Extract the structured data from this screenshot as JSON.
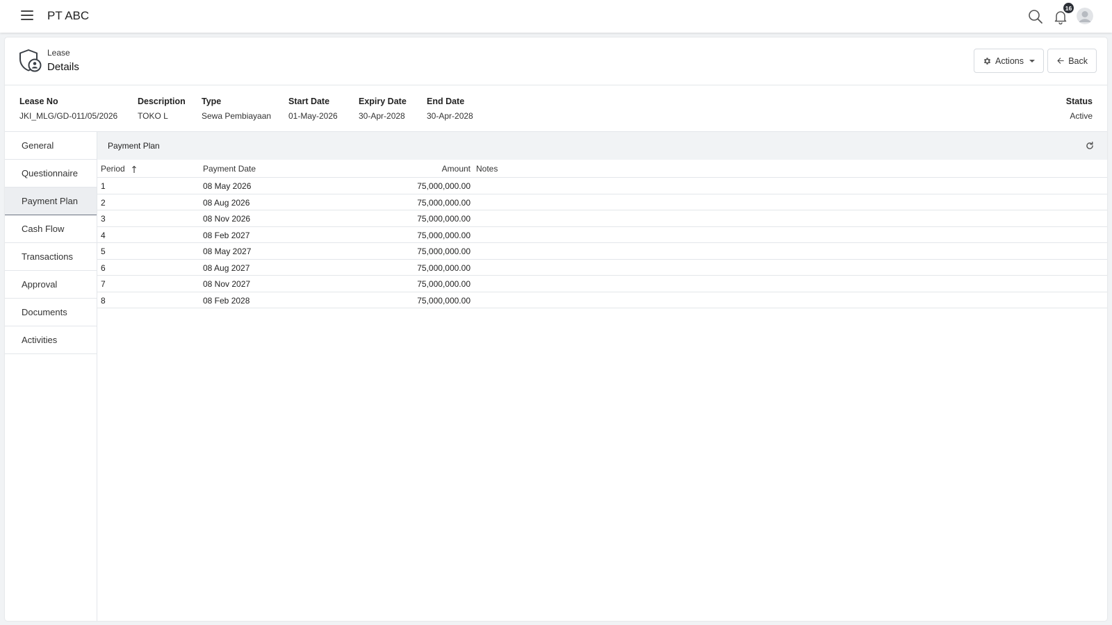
{
  "app": {
    "title": "PT ABC",
    "notification_count": "16"
  },
  "header": {
    "subtitle": "Lease",
    "title": "Details",
    "actions_label": "Actions",
    "back_label": "Back"
  },
  "summary": [
    {
      "label": "Lease No",
      "value": "JKI_MLG/GD-011/05/2026"
    },
    {
      "label": "Description",
      "value": "TOKO L"
    },
    {
      "label": "Type",
      "value": "Sewa Pembiayaan"
    },
    {
      "label": "Start Date",
      "value": "01-May-2026"
    },
    {
      "label": "Expiry Date",
      "value": "30-Apr-2028"
    },
    {
      "label": "End Date",
      "value": "30-Apr-2028"
    },
    {
      "label": "Status",
      "value": "Active"
    }
  ],
  "tabs": [
    {
      "label": "General"
    },
    {
      "label": "Questionnaire"
    },
    {
      "label": "Payment Plan",
      "active": true
    },
    {
      "label": "Cash Flow"
    },
    {
      "label": "Transactions"
    },
    {
      "label": "Approval"
    },
    {
      "label": "Documents"
    },
    {
      "label": "Activities"
    }
  ],
  "panel": {
    "title": "Payment Plan"
  },
  "table": {
    "columns": {
      "period": "Period",
      "payment_date": "Payment Date",
      "amount": "Amount",
      "notes": "Notes"
    },
    "sort": "period-ascending",
    "rows": [
      {
        "period": "1",
        "payment_date": "08 May 2026",
        "amount": "75,000,000.00",
        "notes": ""
      },
      {
        "period": "2",
        "payment_date": "08 Aug 2026",
        "amount": "75,000,000.00",
        "notes": ""
      },
      {
        "period": "3",
        "payment_date": "08 Nov 2026",
        "amount": "75,000,000.00",
        "notes": ""
      },
      {
        "period": "4",
        "payment_date": "08 Feb 2027",
        "amount": "75,000,000.00",
        "notes": ""
      },
      {
        "period": "5",
        "payment_date": "08 May 2027",
        "amount": "75,000,000.00",
        "notes": ""
      },
      {
        "period": "6",
        "payment_date": "08 Aug 2027",
        "amount": "75,000,000.00",
        "notes": ""
      },
      {
        "period": "7",
        "payment_date": "08 Nov 2027",
        "amount": "75,000,000.00",
        "notes": ""
      },
      {
        "period": "8",
        "payment_date": "08 Feb 2028",
        "amount": "75,000,000.00",
        "notes": ""
      }
    ]
  },
  "icons": {
    "menu": "hamburger-menu-icon",
    "search": "search-icon",
    "notifications": "bell-icon",
    "avatar": "user-avatar-icon",
    "module": "shield-user-icon",
    "actions": "gear-icon",
    "back": "arrow-left-icon",
    "refresh": "refresh-icon",
    "sort": "arrow-up-icon"
  },
  "colors": {
    "badge": "#2b2f36",
    "active_tab": "#eceef1",
    "panel_header": "#f1f3f5",
    "page_bg": "#f1f3f5"
  }
}
